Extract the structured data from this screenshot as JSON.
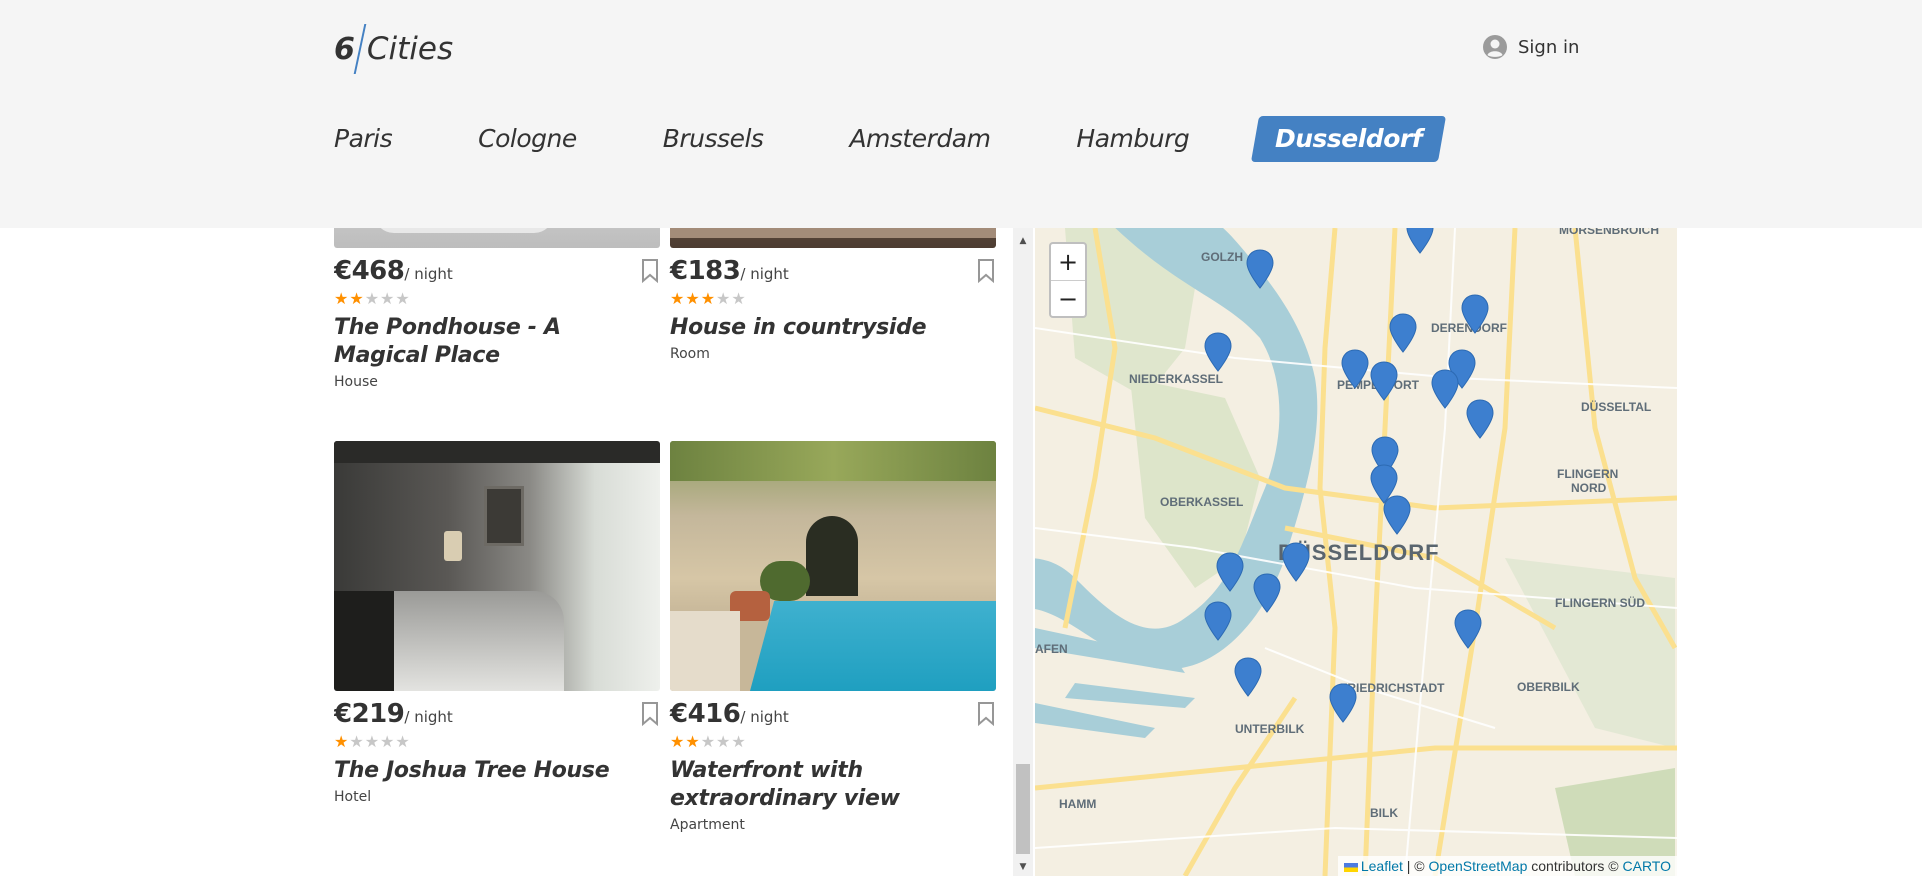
{
  "header": {
    "logo": {
      "number": "6",
      "text": "Cities"
    },
    "signin_label": "Sign in"
  },
  "tabs": [
    {
      "label": "Paris",
      "active": false
    },
    {
      "label": "Cologne",
      "active": false
    },
    {
      "label": "Brussels",
      "active": false
    },
    {
      "label": "Amsterdam",
      "active": false
    },
    {
      "label": "Hamburg",
      "active": false
    },
    {
      "label": "Dusseldorf",
      "active": true
    }
  ],
  "offers": [
    {
      "price": "€468",
      "per_night": "/ night",
      "rating": 2,
      "title": "The Pondhouse - A Magical Place",
      "type": "House"
    },
    {
      "price": "€183",
      "per_night": "/ night",
      "rating": 3,
      "title": "House in countryside",
      "type": "Room"
    },
    {
      "price": "€219",
      "per_night": "/ night",
      "rating": 1,
      "title": "The Joshua Tree House",
      "type": "Hotel"
    },
    {
      "price": "€416",
      "per_night": "/ night",
      "rating": 2,
      "title": "Waterfront with extraordinary view",
      "type": "Apartment"
    }
  ],
  "map": {
    "zoom_in": "+",
    "zoom_out": "−",
    "labels": {
      "morsenbroich": "MORSENBROICH",
      "golzh": "GOLZH",
      "derendorf": "DERENDORF",
      "niederkassel": "NIEDERKASSEL",
      "pempelfort": "PEMPELFORT",
      "dusseltal": "DÜSSELTAL",
      "flingern_nord_1": "FLINGERN",
      "flingern_nord_2": "NORD",
      "oberkassel": "OBERKASSEL",
      "dusseldorf": "DÜSSELDORF",
      "flingern_sud": "FLINGERN SÜD",
      "hafen": "AFEN",
      "friedrichstadt": "FRIEDRICHSTADT",
      "oberbilk": "OBERBILK",
      "unterbilk": "UNTERBILK",
      "hamm": "HAMM",
      "bilk": "BILK"
    },
    "attribution": {
      "leaflet": "Leaflet",
      "sep1": " | © ",
      "osm": "OpenStreetMap",
      "contrib": " contributors © ",
      "carto": "CARTO"
    }
  }
}
